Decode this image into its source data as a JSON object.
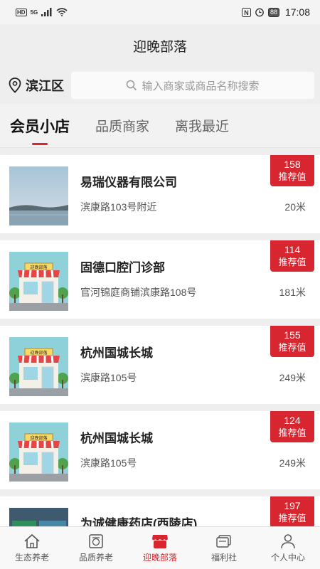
{
  "status_bar": {
    "hd": "HD",
    "signal": "5G",
    "battery": "88",
    "time": "17:08"
  },
  "header": {
    "title": "迎晚部落"
  },
  "location": {
    "name": "滨江区",
    "icon": "location-pin-icon"
  },
  "search": {
    "placeholder": "输入商家或商品名称搜索",
    "icon": "search-icon"
  },
  "tabs": [
    {
      "label": "会员小店",
      "active": true
    },
    {
      "label": "品质商家",
      "active": false
    },
    {
      "label": "离我最近",
      "active": false
    }
  ],
  "shops": [
    {
      "name": "易瑞仪器有限公司",
      "address": "滨康路103号附近",
      "distance": "20米",
      "score": "158",
      "score_label": "推荐值",
      "image": "lake-photo"
    },
    {
      "name": "固德口腔门诊部",
      "address": "官河锦庭商铺滨康路108号",
      "distance": "181米",
      "score": "114",
      "score_label": "推荐值",
      "image": "storefront-illustration"
    },
    {
      "name": "杭州国城长城",
      "address": "滨康路105号",
      "distance": "249米",
      "score": "155",
      "score_label": "推荐值",
      "image": "storefront-illustration"
    },
    {
      "name": "杭州国城长城",
      "address": "滨康路105号",
      "distance": "249米",
      "score": "124",
      "score_label": "推荐值",
      "image": "storefront-illustration"
    },
    {
      "name": "为诚健康药店(西陵店)",
      "address": "",
      "distance": "",
      "score": "197",
      "score_label": "推荐值",
      "image": "pharmacy-photo"
    }
  ],
  "store_sign": "迎晚部落",
  "bottom_nav": [
    {
      "label": "生态养老",
      "icon": "home-icon",
      "active": false
    },
    {
      "label": "品质养老",
      "icon": "coupon-icon",
      "active": false
    },
    {
      "label": "迎晚部落",
      "icon": "shop-icon",
      "active": true
    },
    {
      "label": "福利社",
      "icon": "cards-icon",
      "active": false
    },
    {
      "label": "个人中心",
      "icon": "person-icon",
      "active": false
    }
  ],
  "colors": {
    "accent": "#d7262f",
    "background": "#eeeeee"
  }
}
